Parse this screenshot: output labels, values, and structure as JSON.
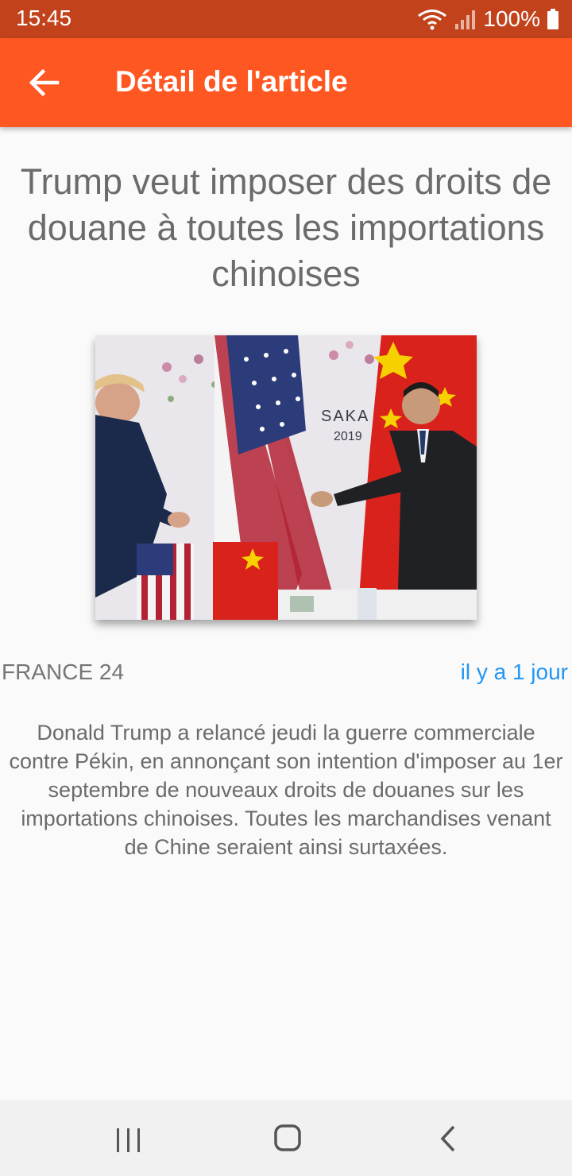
{
  "status_bar": {
    "time": "15:45",
    "battery": "100%",
    "icons": [
      "wifi-icon",
      "signal-icon",
      "battery-icon"
    ]
  },
  "app_bar": {
    "title": "Détail de l'article",
    "back_icon": "arrow-left-icon",
    "color": "#ff5722"
  },
  "article": {
    "title": "Trump veut imposer des droits de douane à toutes les importations chinoises",
    "source": "FRANCE 24",
    "time_ago": "il y a 1 jour",
    "description": "Donald Trump a relancé jeudi la guerre commerciale contre Pékin, en annonçant son intention d'imposer au 1er septembre de nouveaux droits de douanes sur les importations chinoises. Toutes les marchandises venant de Chine seraient ainsi surtaxées.",
    "image_text": "SAKA\n2019"
  },
  "nav_bar": {
    "buttons": [
      "recent-apps-icon",
      "home-icon",
      "back-icon"
    ]
  },
  "colors": {
    "status_bar": "#c2431b",
    "accent": "#ff5722",
    "link": "#2196f3",
    "text": "#6b6b6b"
  }
}
